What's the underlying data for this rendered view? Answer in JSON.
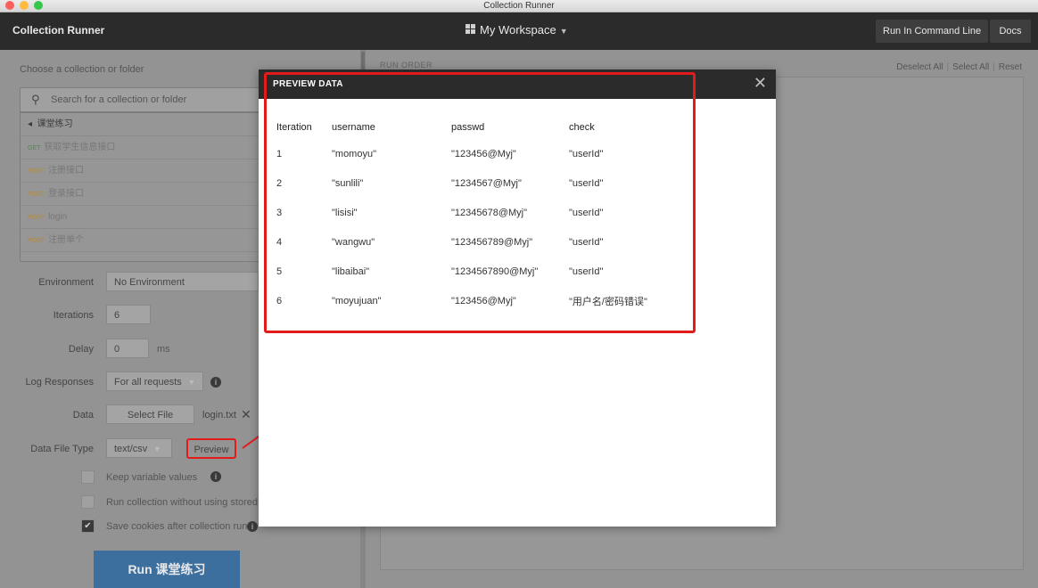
{
  "window": {
    "title": "Collection Runner"
  },
  "header": {
    "app_title": "Collection Runner",
    "workspace": "My Workspace",
    "run_cmd_button": "Run In Command Line",
    "docs_button": "Docs"
  },
  "left": {
    "choose_label": "Choose a collection or folder",
    "search_placeholder": "Search for a collection or folder",
    "folder": "课堂练习",
    "requests": [
      {
        "method": "GET",
        "name": "获取学生信息接口"
      },
      {
        "method": "POST",
        "name": "注册接口"
      },
      {
        "method": "POST",
        "name": "登录接口"
      },
      {
        "method": "POST",
        "name": "login"
      },
      {
        "method": "POST",
        "name": "注册单个"
      }
    ],
    "environment_label": "Environment",
    "environment_value": "No Environment",
    "iterations_label": "Iterations",
    "iterations_value": "6",
    "delay_label": "Delay",
    "delay_value": "0",
    "delay_unit": "ms",
    "log_label": "Log Responses",
    "log_value": "For all requests",
    "data_label": "Data",
    "select_file": "Select File",
    "file_name": "login.txt",
    "file_type_label": "Data File Type",
    "file_type_value": "text/csv",
    "preview_button": "Preview",
    "keep_values": "Keep variable values",
    "run_without": "Run collection without using stored c",
    "save_cookies": "Save cookies after collection run",
    "run_button": "Run 课堂练习"
  },
  "right": {
    "run_order_label": "RUN ORDER",
    "deselect_all": "Deselect All",
    "select_all": "Select All",
    "reset": "Reset"
  },
  "modal": {
    "title": "PREVIEW DATA",
    "columns": [
      "Iteration",
      "username",
      "passwd",
      "check"
    ],
    "rows": [
      [
        "1",
        "\"momoyu\"",
        "\"123456@Myj\"",
        "\"userId\""
      ],
      [
        "2",
        "\"sunlili\"",
        "\"1234567@Myj\"",
        "\"userId\""
      ],
      [
        "3",
        "\"lisisi\"",
        "\"12345678@Myj\"",
        "\"userId\""
      ],
      [
        "4",
        "\"wangwu\"",
        "\"123456789@Myj\"",
        "\"userId\""
      ],
      [
        "5",
        "\"libaibai\"",
        "\"1234567890@Myj\"",
        "\"userId\""
      ],
      [
        "6",
        "\"moyujuan\"",
        "\"123456@Myj\"",
        "\"用户名/密码错误\""
      ]
    ]
  },
  "colors": {
    "highlight": "#e21b1b",
    "run_button": "#3d6f9e",
    "header_bg": "#2b2b2b"
  }
}
